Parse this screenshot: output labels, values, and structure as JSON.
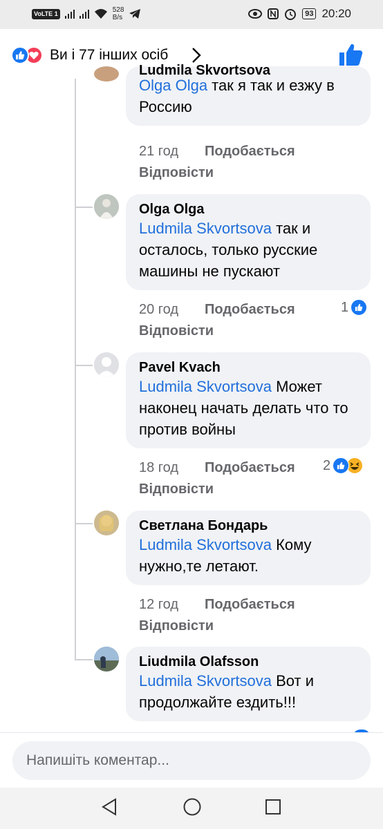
{
  "status_bar": {
    "volte": "VoLTE",
    "sim": "1",
    "speed_value": "528",
    "speed_unit": "B/s",
    "battery": "93",
    "time": "20:20"
  },
  "header": {
    "reaction_summary": "Ви і 77 інших осіб",
    "icons": [
      "like-icon",
      "love-icon",
      "chevron-right-icon",
      "thumbs-up-icon"
    ]
  },
  "colors": {
    "accent": "#1877f2",
    "love": "#f33e58",
    "mention": "#216fdb",
    "bubble": "#f0f2f5",
    "meta": "#65676b"
  },
  "comments": [
    {
      "author": "Ludmila Skvortsova",
      "mention": "Olga Olga",
      "text": " так я так и езжу в Россию",
      "time": "21 год",
      "like_label": "Подобається",
      "reply_label": "Відповісти",
      "reaction_count": ""
    },
    {
      "author": "Olga Olga",
      "mention": "Ludmila Skvortsova",
      "text": " так и осталось, только русские машины не пускают",
      "time": "20 год",
      "like_label": "Подобається",
      "reply_label": "Відповісти",
      "reaction_count": "1"
    },
    {
      "author": "Pavel Kvach",
      "mention": "Ludmila Skvortsova",
      "text": " Может наконец начать делать что то против войны",
      "time": "18 год",
      "like_label": "Подобається",
      "reply_label": "Відповісти",
      "reaction_count": "2"
    },
    {
      "author": "Светлана Бондарь",
      "mention": "Ludmila Skvortsova",
      "text": " Кому нужно,те летают.",
      "time": "12 год",
      "like_label": "Подобається",
      "reply_label": "Відповісти",
      "reaction_count": ""
    },
    {
      "author": "Liudmila Olafsson",
      "mention": "Ludmila Skvortsova",
      "text": " Вот и продолжайте ездить!!!",
      "time": "",
      "like_label": "",
      "reply_label": "",
      "reaction_count": ""
    }
  ],
  "input": {
    "placeholder": "Напишіть коментар..."
  },
  "nav": {
    "icons": [
      "back-icon",
      "home-icon",
      "recents-icon"
    ]
  }
}
